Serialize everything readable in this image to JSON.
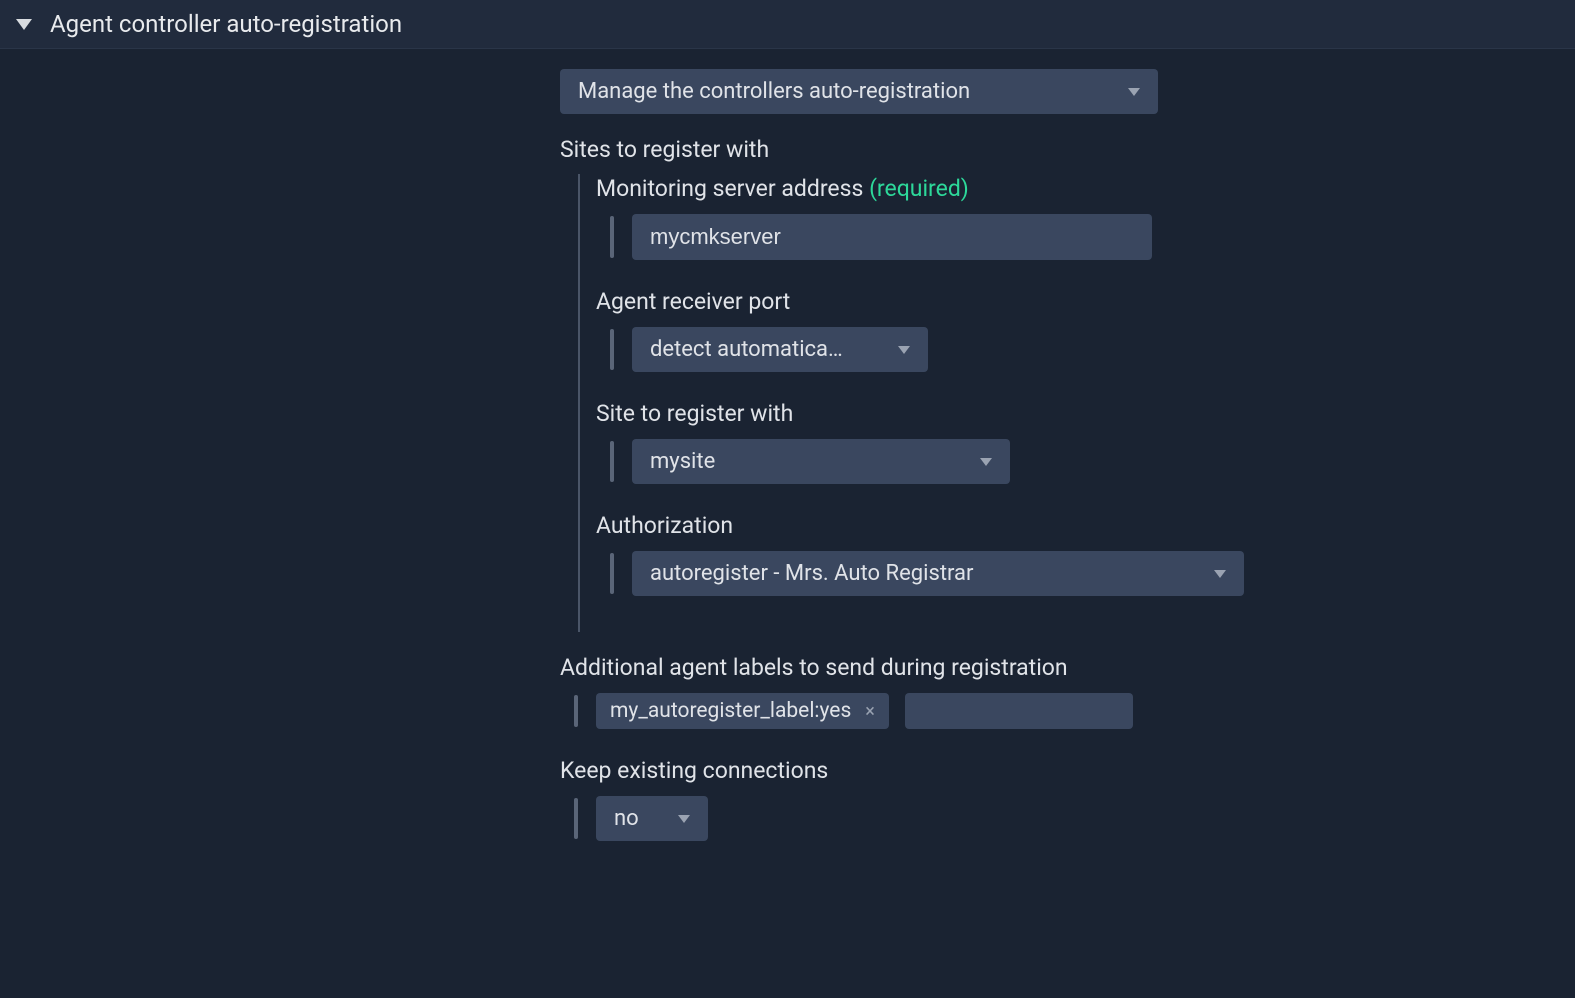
{
  "header": {
    "title": "Agent controller auto-registration"
  },
  "main": {
    "manage_select": "Manage the controllers auto-registration",
    "sites_label": "Sites to register with",
    "fields": {
      "server_address": {
        "label": "Monitoring server address",
        "required": "(required)",
        "value": "mycmkserver"
      },
      "receiver_port": {
        "label": "Agent receiver port",
        "value": "detect automatica…"
      },
      "site": {
        "label": "Site to register with",
        "value": "mysite"
      },
      "authorization": {
        "label": "Authorization",
        "value": "autoregister - Mrs. Auto Registrar"
      }
    },
    "labels_section": {
      "label": "Additional agent labels to send during registration",
      "chip": "my_autoregister_label:yes"
    },
    "keep_connections": {
      "label": "Keep existing connections",
      "value": "no"
    }
  }
}
